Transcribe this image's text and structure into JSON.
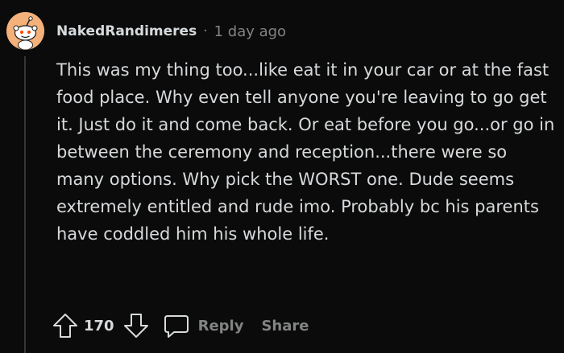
{
  "comment": {
    "username": "NakedRandimeres",
    "separator": "·",
    "timestamp": "1 day ago",
    "body": "This was my thing too...like eat it in your car or at the fast food place. Why even tell anyone you're leaving to go get it. Just do it and come back. Or eat before you go...or go in between the ceremony and reception...there were so many options. Why pick the WORST one. Dude seems extremely entitled and rude imo. Probably bc his parents have coddled him his whole life.",
    "avatar_color": "#f4b17a"
  },
  "actions": {
    "vote_count": "170",
    "reply_label": "Reply",
    "share_label": "Share",
    "upvote_icon": "arrow-up-icon",
    "downvote_icon": "arrow-down-icon",
    "reply_icon": "speech-bubble-icon"
  },
  "colors": {
    "background": "#0b0b0b",
    "text": "#d7dadc",
    "muted": "#818384",
    "thread_line": "#343536"
  }
}
